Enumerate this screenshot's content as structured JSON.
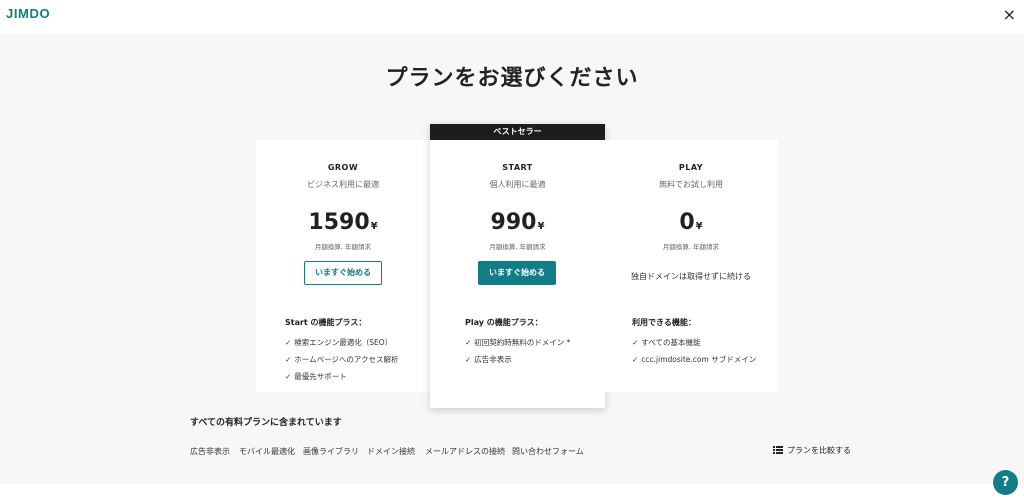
{
  "header": {
    "logo": "JIMDO",
    "close": "×"
  },
  "page_title": "プランをお選びください",
  "plans": {
    "grow": {
      "name": "GROW",
      "subtitle": "ビジネス利用に最適",
      "price": "1590",
      "currency": "¥",
      "billing": "月額換算, 年額請求",
      "cta": "いますぐ始める",
      "features_heading": "Start の機能プラス：",
      "features": [
        "検索エンジン最適化（SEO）",
        "ホームページへのアクセス解析",
        "最優先サポート"
      ]
    },
    "start": {
      "badge": "ベストセラー",
      "name": "START",
      "subtitle": "個人利用に最適",
      "price": "990",
      "currency": "¥",
      "billing": "月額換算, 年額請求",
      "cta": "いますぐ始める",
      "features_heading": "Play の機能プラス：",
      "features": [
        "初回契約時無料のドメイン *",
        "広告非表示"
      ]
    },
    "play": {
      "name": "PLAY",
      "subtitle": "無料でお試し利用",
      "price": "0",
      "currency": "¥",
      "billing": "月額換算, 年額請求",
      "note": "独自ドメインは取得せずに続ける",
      "features_heading": "利用できる機能：",
      "features": [
        "すべての基本機能",
        "ccc.jimdosite.com サブドメイン"
      ]
    }
  },
  "included": {
    "title": "すべての有料プランに含まれています",
    "items": [
      "広告非表示",
      "モバイル最適化",
      "画像ライブラリ",
      "ドメイン接続",
      "メールアドレスの接続",
      "問い合わせフォーム"
    ]
  },
  "compare_label": "プランを比較する",
  "help_label": "?",
  "check_mark": "✓",
  "colors": {
    "accent": "#117d86",
    "badge": "#1d1d1d",
    "background": "#f7f7f7"
  }
}
